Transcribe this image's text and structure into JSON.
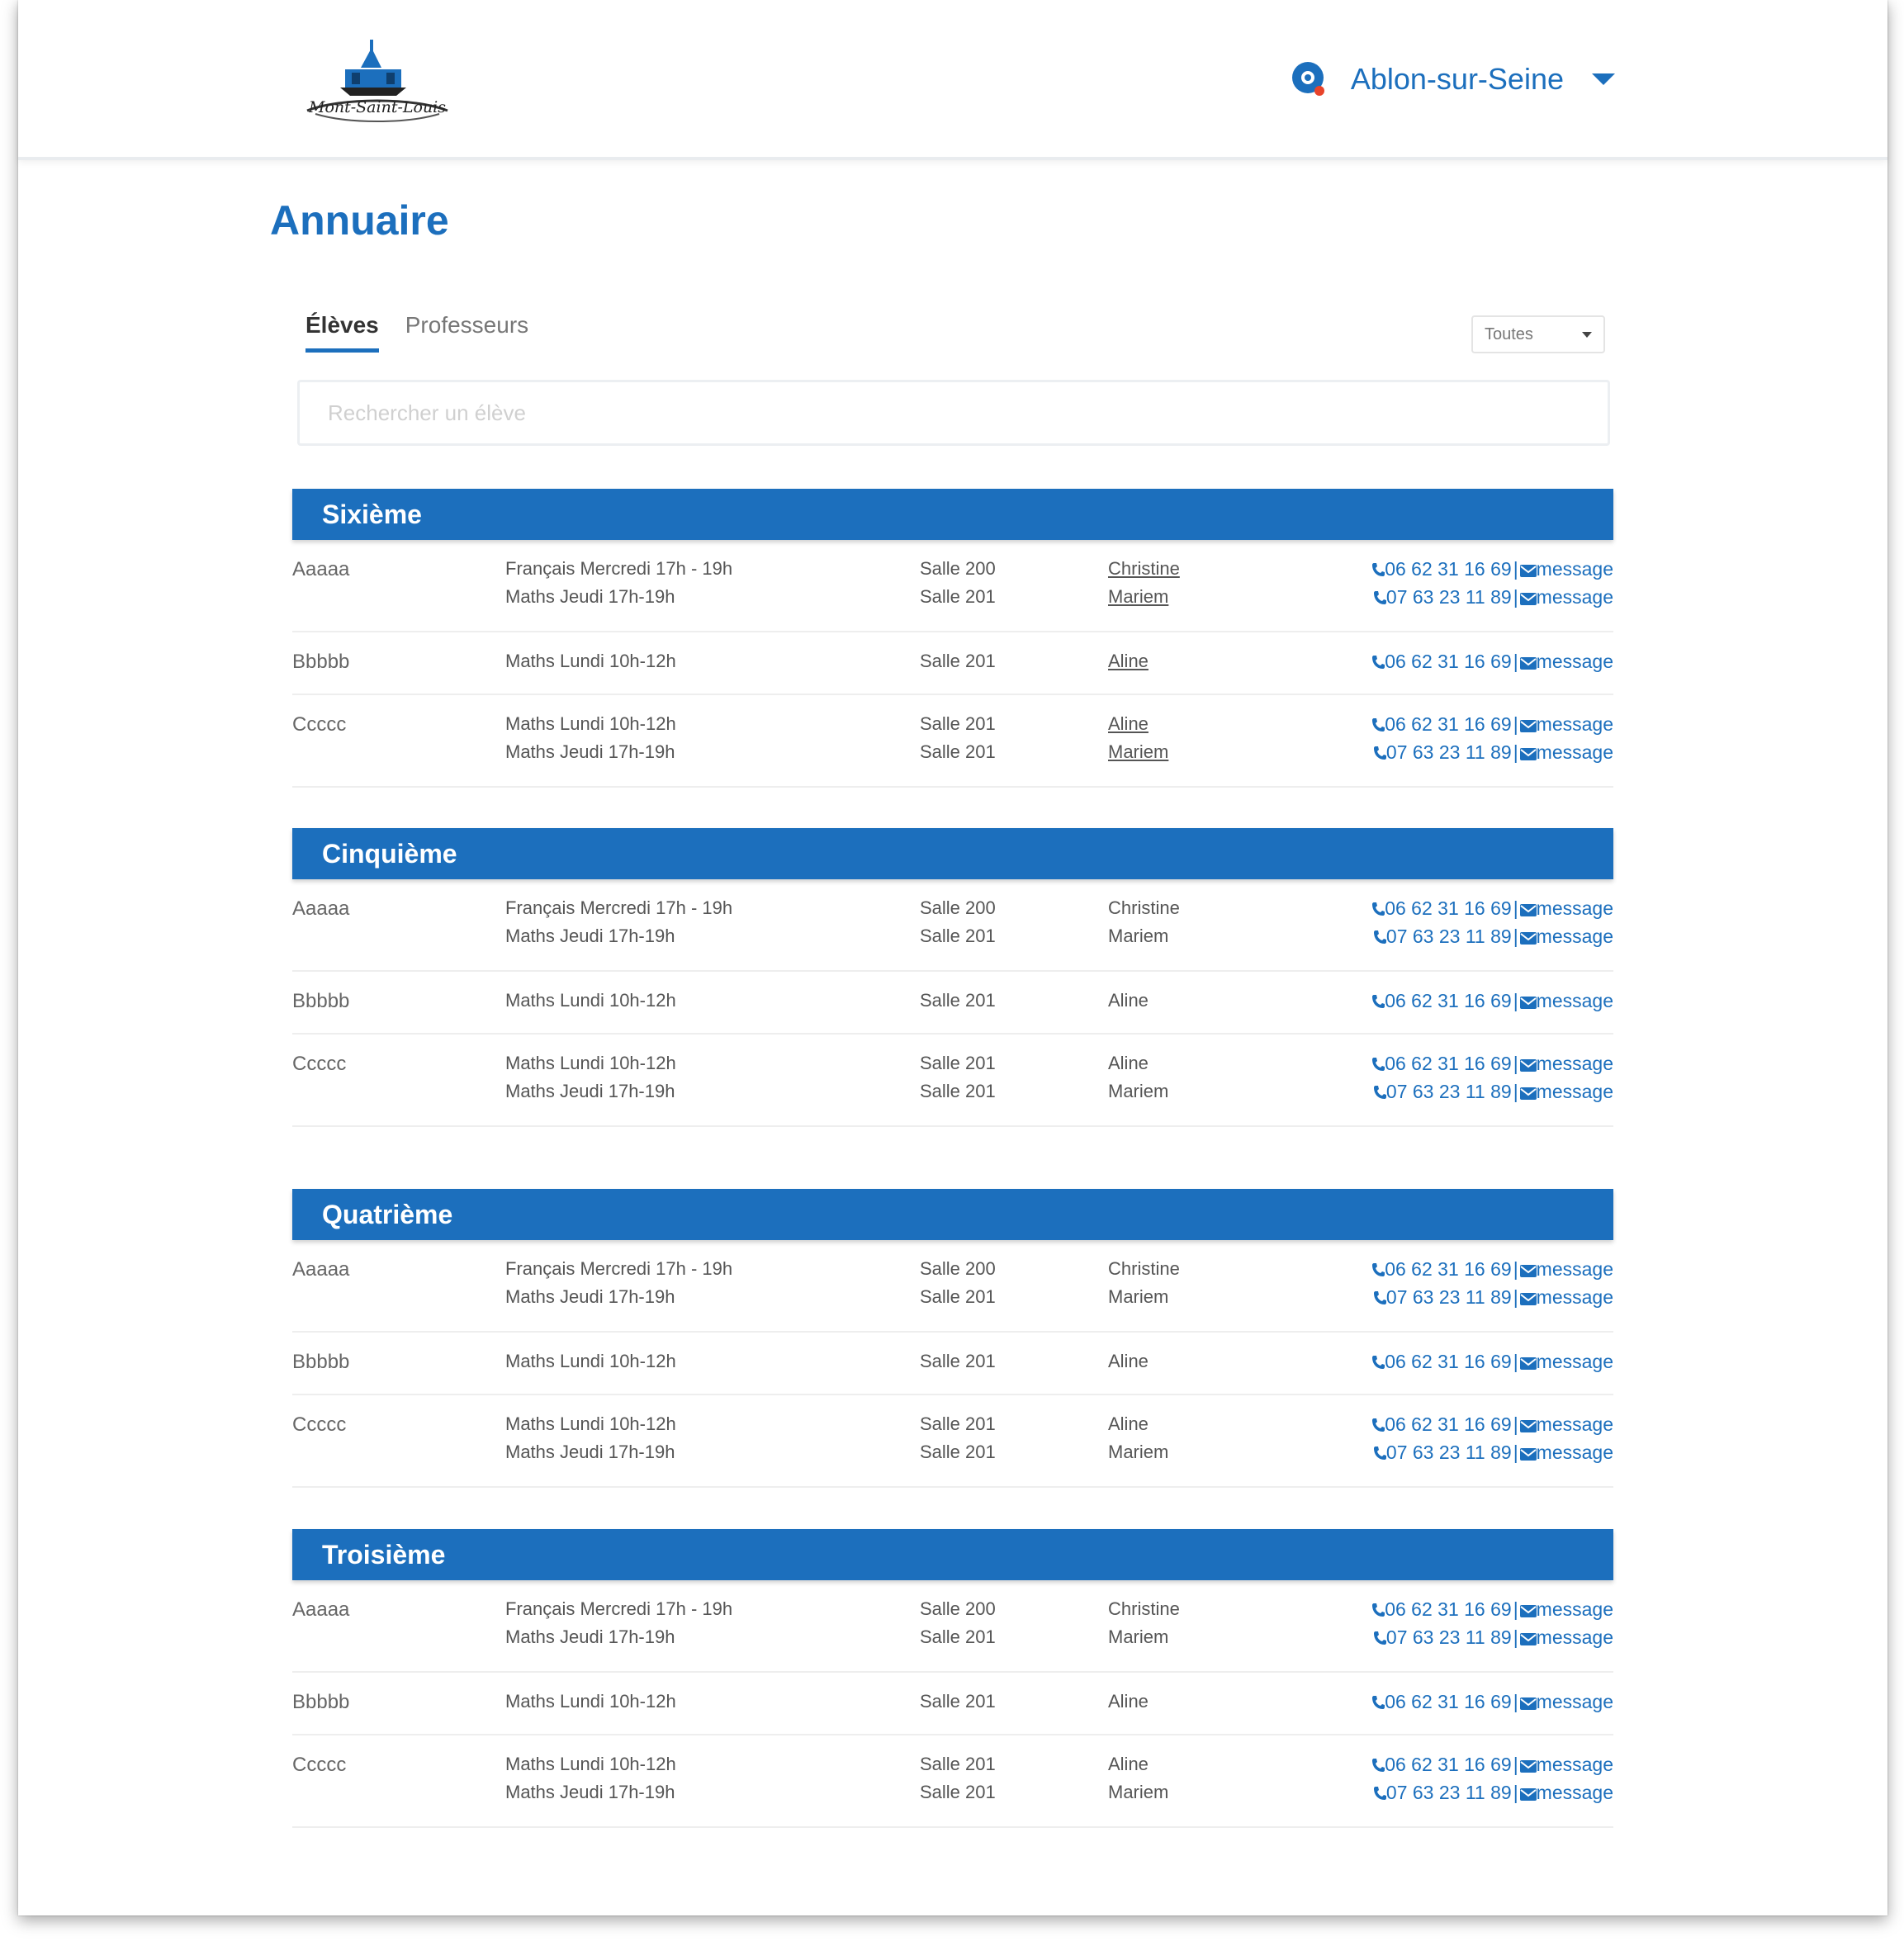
{
  "header": {
    "logo_text": "Mont-Saint-Louis",
    "city": "Ablon-sur-Seine"
  },
  "page_title": "Annuaire",
  "tabs": [
    {
      "label": "Élèves",
      "active": true
    },
    {
      "label": "Professeurs",
      "active": false
    }
  ],
  "filter": {
    "value": "Toutes"
  },
  "search": {
    "placeholder": "Rechercher un élève"
  },
  "colors": {
    "accent": "#1c6fbd"
  },
  "icons": {
    "phone": "phone-icon",
    "message": "envelope-icon",
    "location": "location-pin-icon"
  },
  "sections": [
    {
      "title": "Sixième",
      "rows": [
        {
          "name": "Aaaaa",
          "lines": [
            {
              "course": "Français Mercredi 17h - 19h",
              "room": "Salle 200",
              "teacher": "Christine",
              "phone": "06 62 31 16 69",
              "message": "message"
            },
            {
              "course": "Maths Jeudi 17h-19h",
              "room": "Salle 201",
              "teacher": "Mariem",
              "phone": "07 63 23 11 89",
              "message": "message"
            }
          ]
        },
        {
          "name": "Bbbbb",
          "lines": [
            {
              "course": "Maths Lundi 10h-12h",
              "room": "Salle 201",
              "teacher": "Aline",
              "phone": "06 62 31 16 69",
              "message": "message"
            }
          ]
        },
        {
          "name": "Ccccc",
          "lines": [
            {
              "course": "Maths Lundi 10h-12h",
              "room": "Salle 201",
              "teacher": "Aline",
              "phone": "06 62 31 16 69",
              "message": "message"
            },
            {
              "course": "Maths Jeudi 17h-19h",
              "room": "Salle 201",
              "teacher": "Mariem",
              "phone": "07 63 23 11 89",
              "message": "message"
            }
          ]
        }
      ]
    },
    {
      "title": "Cinquième",
      "rows": [
        {
          "name": "Aaaaa",
          "lines": [
            {
              "course": "Français Mercredi 17h - 19h",
              "room": "Salle 200",
              "teacher": "Christine",
              "phone": "06 62 31 16 69",
              "message": "message"
            },
            {
              "course": "Maths Jeudi 17h-19h",
              "room": "Salle 201",
              "teacher": "Mariem",
              "phone": "07 63 23 11 89",
              "message": "message"
            }
          ]
        },
        {
          "name": "Bbbbb",
          "lines": [
            {
              "course": "Maths Lundi 10h-12h",
              "room": "Salle 201",
              "teacher": "Aline",
              "phone": "06 62 31 16 69",
              "message": "message"
            }
          ]
        },
        {
          "name": "Ccccc",
          "lines": [
            {
              "course": "Maths Lundi 10h-12h",
              "room": "Salle 201",
              "teacher": "Aline",
              "phone": "06 62 31 16 69",
              "message": "message"
            },
            {
              "course": "Maths Jeudi 17h-19h",
              "room": "Salle 201",
              "teacher": "Mariem",
              "phone": "07 63 23 11 89",
              "message": "message"
            }
          ]
        }
      ]
    },
    {
      "title": "Quatrième",
      "rows": [
        {
          "name": "Aaaaa",
          "lines": [
            {
              "course": "Français Mercredi 17h - 19h",
              "room": "Salle 200",
              "teacher": "Christine",
              "phone": "06 62 31 16 69",
              "message": "message"
            },
            {
              "course": "Maths Jeudi 17h-19h",
              "room": "Salle 201",
              "teacher": "Mariem",
              "phone": "07 63 23 11 89",
              "message": "message"
            }
          ]
        },
        {
          "name": "Bbbbb",
          "lines": [
            {
              "course": "Maths Lundi 10h-12h",
              "room": "Salle 201",
              "teacher": "Aline",
              "phone": "06 62 31 16 69",
              "message": "message"
            }
          ]
        },
        {
          "name": "Ccccc",
          "lines": [
            {
              "course": "Maths Lundi 10h-12h",
              "room": "Salle 201",
              "teacher": "Aline",
              "phone": "06 62 31 16 69",
              "message": "message"
            },
            {
              "course": "Maths Jeudi 17h-19h",
              "room": "Salle 201",
              "teacher": "Mariem",
              "phone": "07 63 23 11 89",
              "message": "message"
            }
          ]
        }
      ]
    },
    {
      "title": "Troisième",
      "rows": [
        {
          "name": "Aaaaa",
          "lines": [
            {
              "course": "Français Mercredi 17h - 19h",
              "room": "Salle 200",
              "teacher": "Christine",
              "phone": "06 62 31 16 69",
              "message": "message"
            },
            {
              "course": "Maths Jeudi 17h-19h",
              "room": "Salle 201",
              "teacher": "Mariem",
              "phone": "07 63 23 11 89",
              "message": "message"
            }
          ]
        },
        {
          "name": "Bbbbb",
          "lines": [
            {
              "course": "Maths Lundi 10h-12h",
              "room": "Salle 201",
              "teacher": "Aline",
              "phone": "06 62 31 16 69",
              "message": "message"
            }
          ]
        },
        {
          "name": "Ccccc",
          "lines": [
            {
              "course": "Maths Lundi 10h-12h",
              "room": "Salle 201",
              "teacher": "Aline",
              "phone": "06 62 31 16 69",
              "message": "message"
            },
            {
              "course": "Maths Jeudi 17h-19h",
              "room": "Salle 201",
              "teacher": "Mariem",
              "phone": "07 63 23 11 89",
              "message": "message"
            }
          ]
        }
      ]
    }
  ]
}
